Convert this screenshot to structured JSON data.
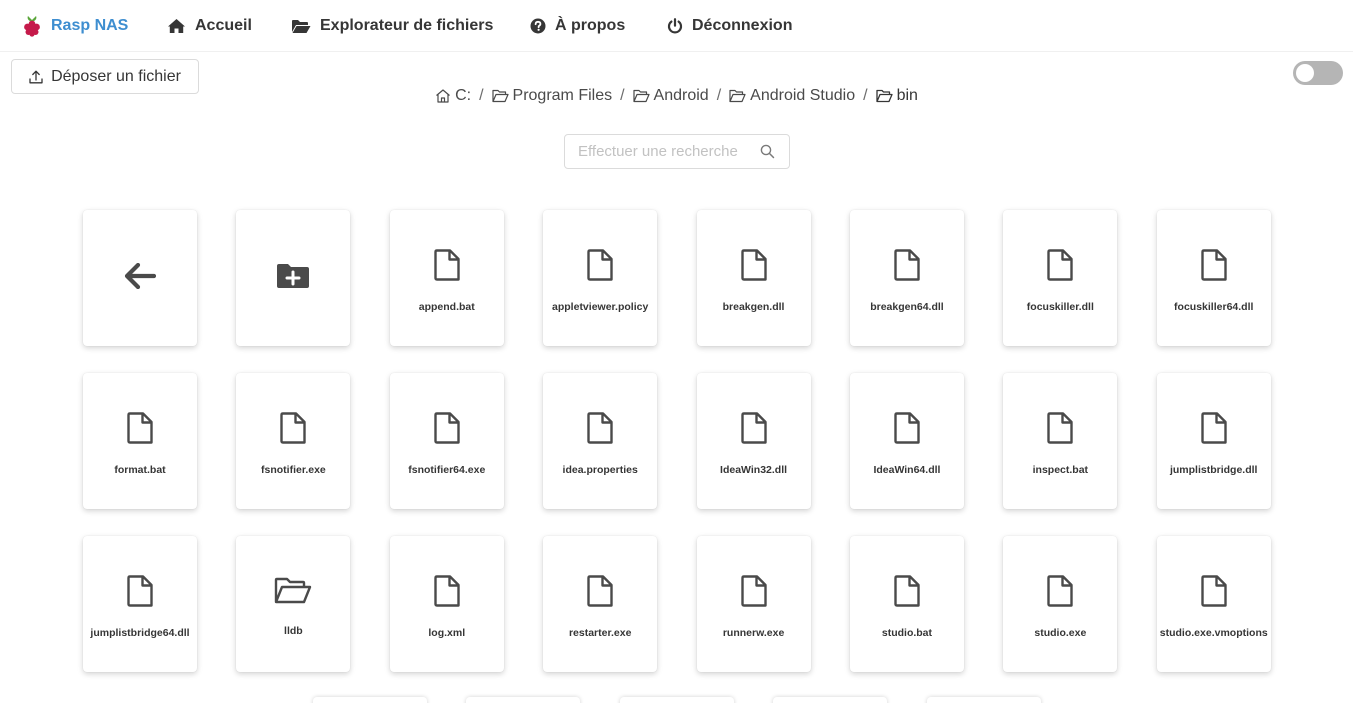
{
  "navbar": {
    "brand": "Rasp NAS",
    "home": "Accueil",
    "explorer": "Explorateur de fichiers",
    "about": "À propos",
    "logout": "Déconnexion"
  },
  "upload": {
    "label": "Déposer un fichier",
    "icon": "upload-icon"
  },
  "toggle": {
    "on": false
  },
  "breadcrumb": [
    {
      "label": "C:",
      "icon": "home-icon"
    },
    {
      "label": "Program Files",
      "icon": "folder-open-icon"
    },
    {
      "label": "Android",
      "icon": "folder-open-icon"
    },
    {
      "label": "Android Studio",
      "icon": "folder-open-icon"
    },
    {
      "label": "bin",
      "icon": "folder-open-icon"
    }
  ],
  "breadcrumb_separator": "/",
  "search": {
    "placeholder": "Effectuer une recherche"
  },
  "items": [
    {
      "type": "back",
      "label": ""
    },
    {
      "type": "new-folder",
      "label": ""
    },
    {
      "type": "file",
      "label": "append.bat"
    },
    {
      "type": "file",
      "label": "appletviewer.policy"
    },
    {
      "type": "file",
      "label": "breakgen.dll"
    },
    {
      "type": "file",
      "label": "breakgen64.dll"
    },
    {
      "type": "file",
      "label": "focuskiller.dll"
    },
    {
      "type": "file",
      "label": "focuskiller64.dll"
    },
    {
      "type": "file",
      "label": "format.bat"
    },
    {
      "type": "file",
      "label": "fsnotifier.exe"
    },
    {
      "type": "file",
      "label": "fsnotifier64.exe"
    },
    {
      "type": "file",
      "label": "idea.properties"
    },
    {
      "type": "file",
      "label": "IdeaWin32.dll"
    },
    {
      "type": "file",
      "label": "IdeaWin64.dll"
    },
    {
      "type": "file",
      "label": "inspect.bat"
    },
    {
      "type": "file",
      "label": "jumplistbridge.dll"
    },
    {
      "type": "file",
      "label": "jumplistbridge64.dll"
    },
    {
      "type": "folder",
      "label": "lldb"
    },
    {
      "type": "file",
      "label": "log.xml"
    },
    {
      "type": "file",
      "label": "restarter.exe"
    },
    {
      "type": "file",
      "label": "runnerw.exe"
    },
    {
      "type": "file",
      "label": "studio.bat"
    },
    {
      "type": "file",
      "label": "studio.exe"
    },
    {
      "type": "file",
      "label": "studio.exe.vmoptions"
    }
  ],
  "colors": {
    "brand": "#3e8ed0",
    "text": "#363636",
    "toggle_off": "#b5b5b5"
  }
}
